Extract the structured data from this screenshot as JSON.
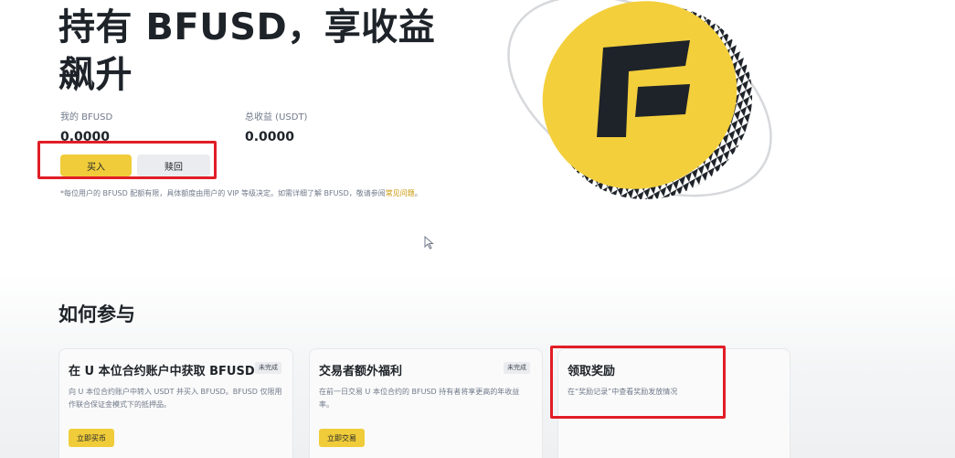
{
  "hero": {
    "title": "持有 BFUSD，享收益飙升"
  },
  "stats": {
    "my_bfusd": {
      "label": "我的 BFUSD",
      "value": "0.0000"
    },
    "total_earnings": {
      "label": "总收益 (USDT)",
      "value": "0.0000"
    }
  },
  "actions": {
    "buy_label": "买入",
    "redeem_label": "赎回"
  },
  "note": {
    "text": "*每位用户的 BFUSD 配额有限，具体额度由用户的 VIP 等级决定。如需详细了解 BFUSD，敬请参阅",
    "link_text": "常见问题",
    "suffix": "。"
  },
  "how_to": {
    "title": "如何参与",
    "cards": [
      {
        "title": "在 U 本位合约账户中获取 BFUSD",
        "badge": "未完成",
        "desc": "向 U 本位合约账户中转入 USDT 并买入 BFUSD。BFUSD 仅限用作联合保证金模式下的抵押品。",
        "button": "立即买币"
      },
      {
        "title": "交易者额外福利",
        "badge": "未完成",
        "desc": "在前一日交易 U 本位合约的 BFUSD 持有者将享更高的年收益率。",
        "button": "立即交易"
      },
      {
        "title": "领取奖励",
        "desc": "在“奖励记录”中查看奖励发放情况"
      }
    ]
  },
  "colors": {
    "accent": "#f0cc3a",
    "highlight": "#e11d26",
    "coin_face": "#f3cf3c",
    "logo": "#1e2329"
  },
  "icons": {
    "coin_logo": "bfusd-coin-icon",
    "cursor": "mouse-cursor-icon"
  }
}
